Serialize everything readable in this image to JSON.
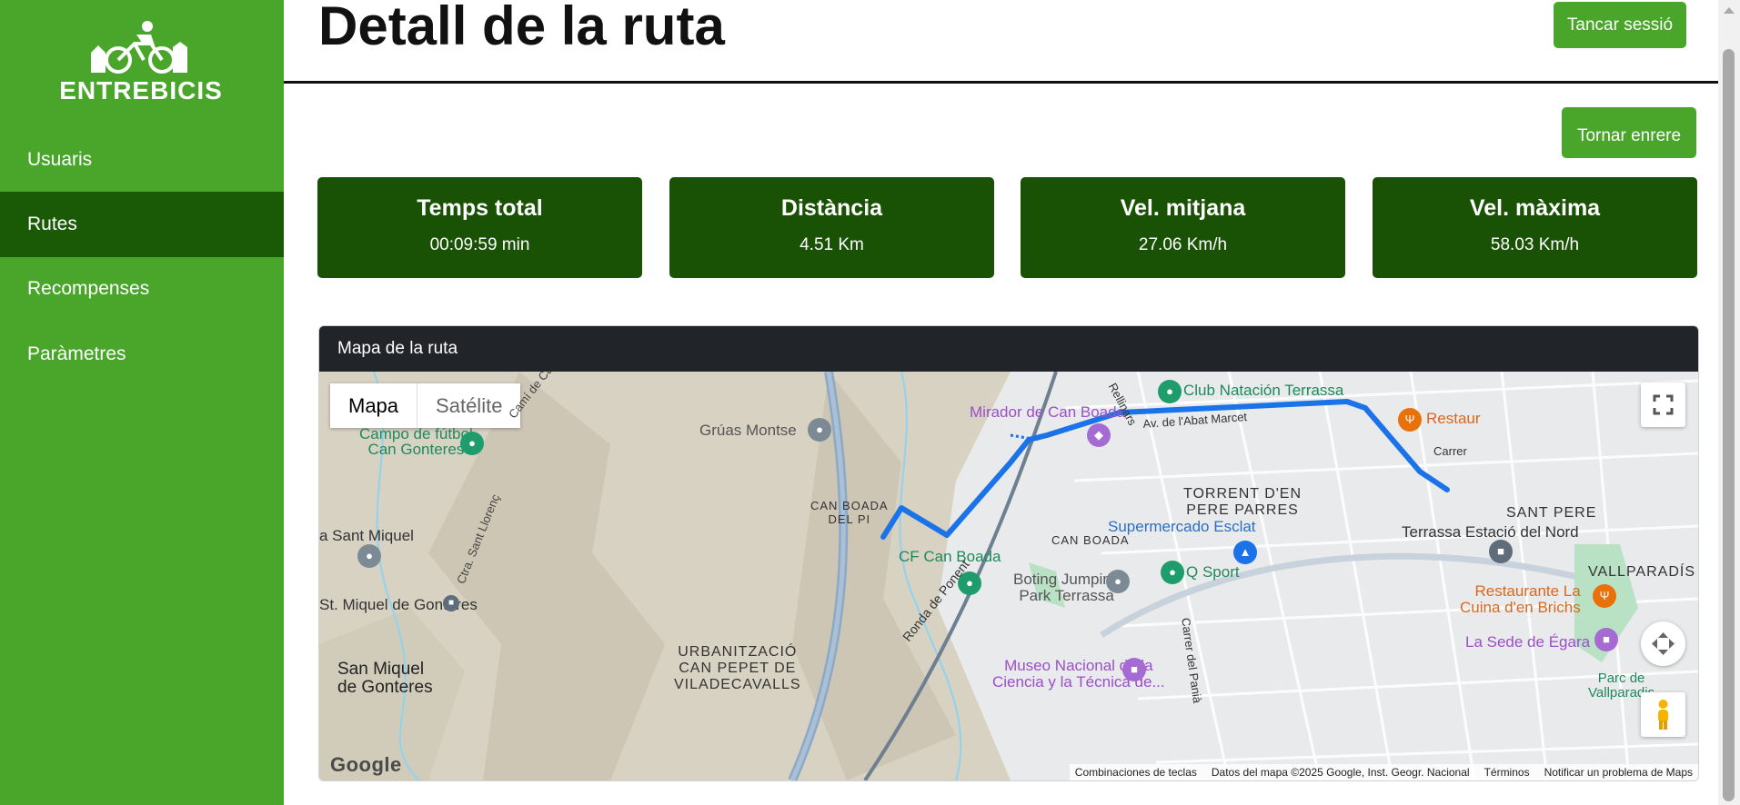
{
  "brand": {
    "name": "ENTREBICIS"
  },
  "sidebar": {
    "items": [
      {
        "label": "Usuaris"
      },
      {
        "label": "Rutes"
      },
      {
        "label": "Recompenses"
      },
      {
        "label": "Paràmetres"
      }
    ],
    "active_index": 1
  },
  "header": {
    "title": "Detall de la ruta",
    "logout_label": "Tancar sessió"
  },
  "actions": {
    "back_label": "Tornar enrere"
  },
  "stats": [
    {
      "title": "Temps total",
      "value": "00:09:59 min"
    },
    {
      "title": "Distància",
      "value": "4.51 Km"
    },
    {
      "title": "Vel. mitjana",
      "value": "27.06 Km/h"
    },
    {
      "title": "Vel. màxima",
      "value": "58.03 Km/h"
    }
  ],
  "map": {
    "header": "Mapa de la ruta",
    "type_map": "Mapa",
    "type_satellite": "Satélite",
    "route_color": "#1a73e8",
    "labels": {
      "campo_futbol": "Campo de fútbol\nCan Gonteres",
      "gruas": "Grúas Montse",
      "mirador": "Mirador de Can Boada",
      "club_natacion": "Club Natación Terrassa",
      "restaurant_top": "Restaura",
      "torrent": "TORRENT D'EN\nPERE PARRES",
      "supermercado": "Supermercado Esclat",
      "can_boada_pi": "CAN BOADA\nDEL PI",
      "can_boada": "CAN BOADA",
      "cf_can_boada": "CF Can Boada",
      "terrassa_estacio": "Terrassa Estació del Nord",
      "sant_pere": "SANT PERE",
      "vallparadis": "VALLPARADÍS",
      "q_sport": "Q Sport",
      "boting": "Boting Jumping\nPark Terrassa",
      "restaurante_cuina": "Restaurante La\nCuina d'en Brichs",
      "sede_egara": "La Sede de Égara",
      "museo": "Museo Nacional de la\nCiencia y la Técnica de...",
      "parc": "Parc de\nVallparadis",
      "sant_miquel": "a Sant Miquel",
      "st_miquel_gonteres": "St. Miquel de Gonteres",
      "san_miquel_gonteres": "San Miquel\nde Gonteres",
      "urbanitzacio": "URBANITZACIÓ\nCAN PEPET DE\nVILADECAVALLS",
      "cami": "Camí de Can Gonteres",
      "ctra": "Ctra. Sant Llorenç",
      "ronda": "Ronda de Ponent",
      "abat": "Av. de l'Abat Marcet",
      "rellinars": "Rellinars",
      "carrer_pania": "Carrer del Panià",
      "carrer": "Carrer"
    },
    "attribution": {
      "shortcuts": "Combinaciones de teclas",
      "data": "Datos del mapa ©2025 Google, Inst. Geogr. Nacional",
      "terms": "Términos",
      "report": "Notificar un problema de Maps"
    },
    "google_logo": "Google"
  }
}
